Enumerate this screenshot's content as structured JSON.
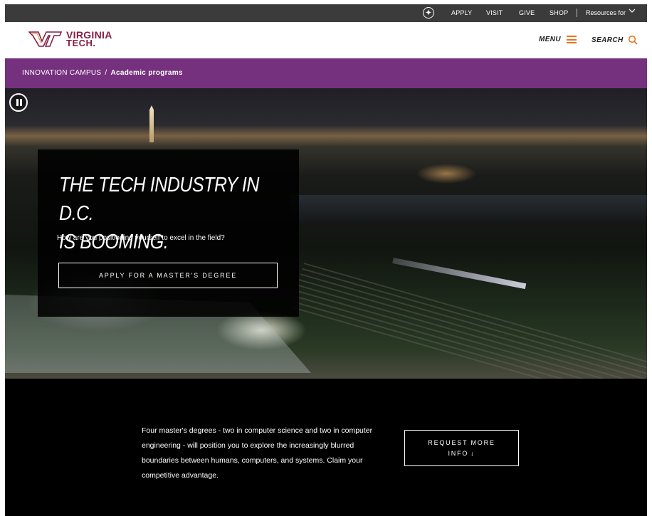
{
  "utility_bar": {
    "accessibility_icon": "accessibility-icon",
    "links": [
      "APPLY",
      "VISIT",
      "GIVE",
      "SHOP"
    ],
    "resources_label": "Resources for"
  },
  "header": {
    "logo_line1": "VIRGINIA",
    "logo_line2": "TECH.",
    "menu_label": "MENU",
    "search_label": "SEARCH"
  },
  "breadcrumb": {
    "parent": "INNOVATION CAMPUS",
    "separator": "/",
    "current": "Academic programs"
  },
  "hero": {
    "title_line1": "THE TECH INDUSTRY IN D.C.",
    "title_line2": "IS BOOMING.",
    "subtitle": "How are you positioning yourself to excel in the field?",
    "cta_label": "APPLY FOR A MASTER'S DEGREE"
  },
  "lower": {
    "blurb": "Four master's degrees - two in computer science and two in computer engineering - will position you to explore the increasingly blurred boundaries between humans, computers, and systems. Claim your competitive advantage.",
    "cta_line1": "REQUEST MORE",
    "cta_line2": "INFO"
  },
  "colors": {
    "maroon": "#861F41",
    "orange": "#E5751F",
    "purple": "#75317E",
    "utility_bg": "#3b3b3b"
  }
}
